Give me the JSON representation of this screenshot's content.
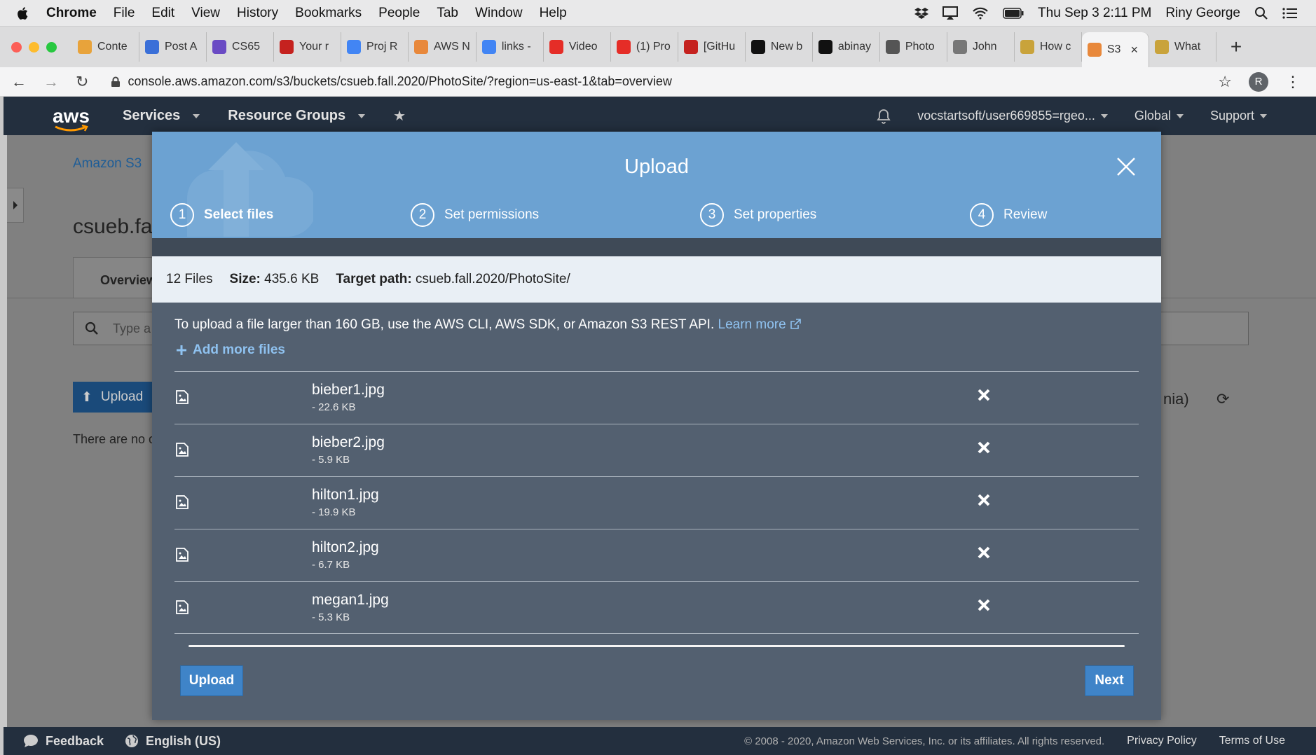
{
  "menubar": {
    "app": "Chrome",
    "items": [
      "File",
      "Edit",
      "View",
      "History",
      "Bookmarks",
      "People",
      "Tab",
      "Window",
      "Help"
    ],
    "datetime": "Thu Sep 3  2:11 PM",
    "user": "Riny George"
  },
  "tabs": [
    {
      "label": "Conte",
      "color": "#e8a33b"
    },
    {
      "label": "Post A",
      "color": "#3a6fd8"
    },
    {
      "label": "CS65",
      "color": "#6a4bc4"
    },
    {
      "label": "Your r",
      "color": "#c5221f"
    },
    {
      "label": "Proj R",
      "color": "#4285f4"
    },
    {
      "label": "AWS N",
      "color": "#e8883b"
    },
    {
      "label": "links -",
      "color": "#4285f4"
    },
    {
      "label": "Video",
      "color": "#e52d27"
    },
    {
      "label": "(1) Pro",
      "color": "#e52d27"
    },
    {
      "label": "[GitHu",
      "color": "#c5221f"
    },
    {
      "label": "New b",
      "color": "#111111"
    },
    {
      "label": "abinay",
      "color": "#111111"
    },
    {
      "label": "Photo",
      "color": "#555555"
    },
    {
      "label": "John",
      "color": "#777777"
    },
    {
      "label": "How c",
      "color": "#c9a33b"
    },
    {
      "label": "S3",
      "color": "#e8883b",
      "active": true
    },
    {
      "label": "What",
      "color": "#c9a33b"
    }
  ],
  "address": {
    "url": "console.aws.amazon.com/s3/buckets/csueb.fall.2020/PhotoSite/?region=us-east-1&tab=overview",
    "avatar_letter": "R"
  },
  "aws_nav": {
    "logo": "aws",
    "services": "Services",
    "resource_groups": "Resource Groups",
    "account": "vocstartsoft/user669855=rgeo...",
    "region": "Global",
    "support": "Support"
  },
  "background_page": {
    "breadcrumb": "Amazon S3",
    "bucket_title": "csueb.fa",
    "overview_tab": "Overview",
    "search_placeholder": "Type a",
    "upload_button": "Upload",
    "empty_text": "There are no o",
    "region_fragment": "nia)"
  },
  "modal": {
    "title": "Upload",
    "steps": [
      {
        "num": "1",
        "label": "Select files",
        "active": true
      },
      {
        "num": "2",
        "label": "Set permissions"
      },
      {
        "num": "3",
        "label": "Set properties"
      },
      {
        "num": "4",
        "label": "Review"
      }
    ],
    "summary": {
      "files": "12 Files",
      "size_label": "Size:",
      "size_value": "435.6 KB",
      "target_label": "Target path:",
      "target_value": "csueb.fall.2020/PhotoSite/"
    },
    "notice": "To upload a file larger than 160 GB, use the AWS CLI, AWS SDK, or Amazon S3 REST API.",
    "learn_more": "Learn more",
    "add_more": "Add more files",
    "files": [
      {
        "name": "bieber1.jpg",
        "size": "- 22.6 KB"
      },
      {
        "name": "bieber2.jpg",
        "size": "- 5.9 KB"
      },
      {
        "name": "hilton1.jpg",
        "size": "- 19.9 KB"
      },
      {
        "name": "hilton2.jpg",
        "size": "- 6.7 KB"
      },
      {
        "name": "megan1.jpg",
        "size": "- 5.3 KB"
      }
    ],
    "upload_button": "Upload",
    "next_button": "Next"
  },
  "footer": {
    "feedback": "Feedback",
    "language": "English (US)",
    "copyright": "© 2008 - 2020, Amazon Web Services, Inc. or its affiliates. All rights reserved.",
    "privacy": "Privacy Policy",
    "terms": "Terms of Use"
  }
}
